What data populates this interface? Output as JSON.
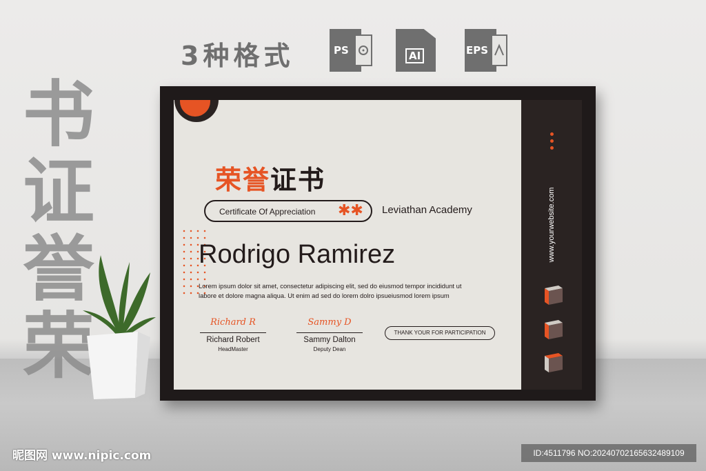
{
  "header": {
    "heading": "3种格式",
    "formats": [
      {
        "label": "PS",
        "icon": "ps-file-icon"
      },
      {
        "label": "AI",
        "icon": "ai-file-icon"
      },
      {
        "label": "EPS",
        "icon": "eps-file-icon"
      }
    ]
  },
  "vertical_text": [
    "书",
    "证",
    "誉",
    "荣"
  ],
  "certificate": {
    "title_red": "荣誉",
    "title_black": "证书",
    "subtitle": "Certificate Of Appreciation",
    "stars": "✱✱",
    "academy": "Leviathan Academy",
    "recipient": "Rodrigo Ramirez",
    "body": "Lorem ipsum dolor sit amet, consectetur adipiscing elit, sed do eiusmod tempor incididunt ut labore et dolore magna aliqua. Ut enim ad sed do lorem dolro ipsueiusmod lorem ipsum",
    "signatures": [
      {
        "script": "Richard R",
        "name": "Richard Robert",
        "role": "HeadMaster"
      },
      {
        "script": "Sammy D",
        "name": "Sammy Dalton",
        "role": "Deputy Dean"
      }
    ],
    "thanks": "THANK YOUR FOR PARTICIPATION",
    "website": "www.yourwebsite.com"
  },
  "footer": {
    "left": "昵图网 www.nipic.com",
    "right": "ID:4511796 NO:20240702165632489109"
  },
  "colors": {
    "accent": "#e65424",
    "dark": "#231b1b",
    "paper": "#e7e5e0",
    "gray_text": "#6f6f6f"
  }
}
